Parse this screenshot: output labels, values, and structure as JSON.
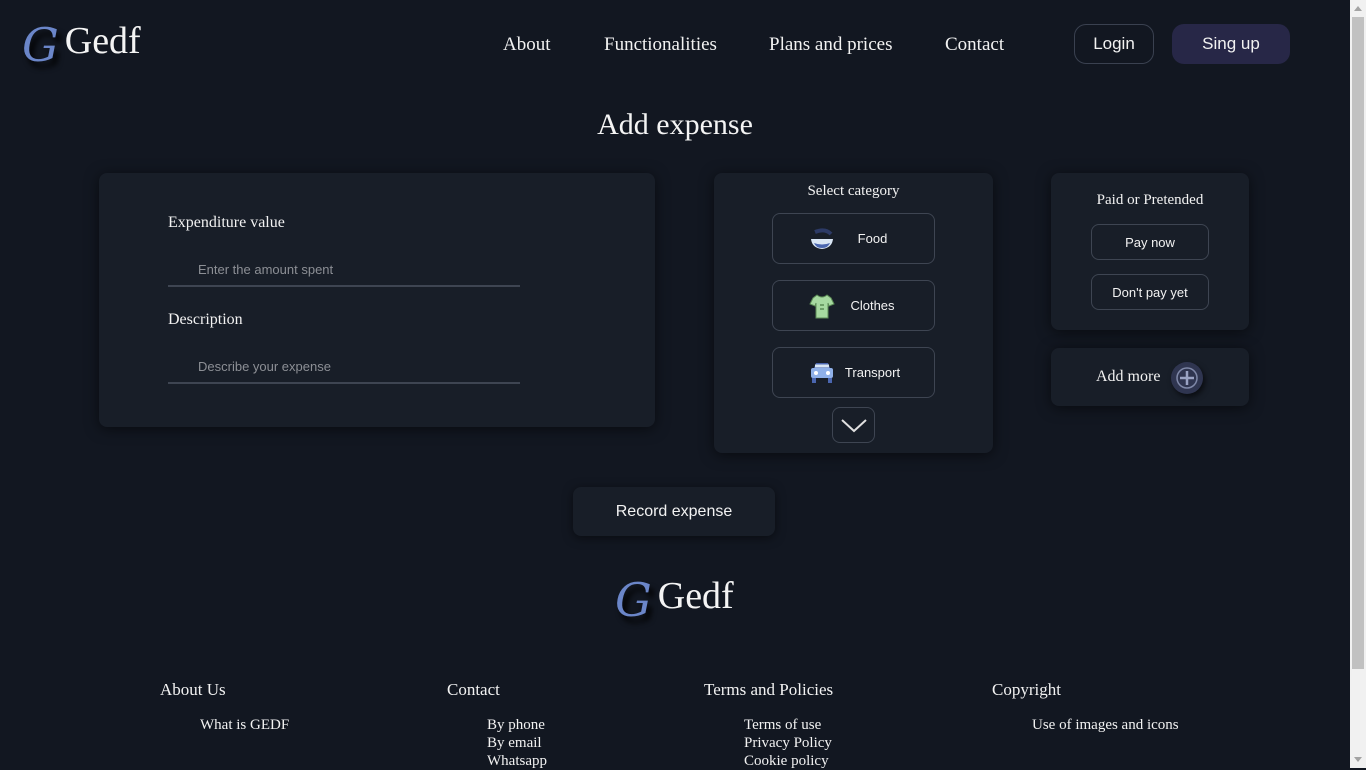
{
  "brand": {
    "mark": "G",
    "name": "Gedf"
  },
  "nav": {
    "links": [
      "About",
      "Functionalities",
      "Plans and prices",
      "Contact"
    ],
    "login": "Login",
    "signup": "Sing up"
  },
  "page_title": "Add expense",
  "form": {
    "value_label": "Expenditure value",
    "value_placeholder": "Enter the amount spent",
    "description_label": "Description",
    "description_placeholder": "Describe your expense"
  },
  "categories": {
    "title": "Select category",
    "items": [
      {
        "label": "Food",
        "icon": "food-bowl-icon"
      },
      {
        "label": "Clothes",
        "icon": "shirt-icon"
      },
      {
        "label": "Transport",
        "icon": "car-icon"
      }
    ],
    "more_icon": "chevron-down-icon"
  },
  "payment": {
    "title": "Paid or Pretended",
    "pay_now": "Pay now",
    "pay_later": "Don't pay yet"
  },
  "add_more": {
    "label": "Add more",
    "icon": "plus-circle-icon"
  },
  "record_button": "Record expense",
  "footer": {
    "brand_mark": "G",
    "brand_name": "Gedf",
    "columns": [
      {
        "title": "About Us",
        "items": [
          "What is GEDF"
        ]
      },
      {
        "title": "Contact",
        "items": [
          "By phone",
          "By email",
          "Whatsapp"
        ]
      },
      {
        "title": "Terms and Policies",
        "items": [
          "Terms of use",
          "Privacy Policy",
          "Cookie policy"
        ]
      },
      {
        "title": "Copyright",
        "items": [
          "Use of images and icons"
        ]
      }
    ]
  },
  "colors": {
    "background": "#121721",
    "card": "#181e28",
    "signup_button": "#272747",
    "logo_mark": "#6b86c9"
  }
}
